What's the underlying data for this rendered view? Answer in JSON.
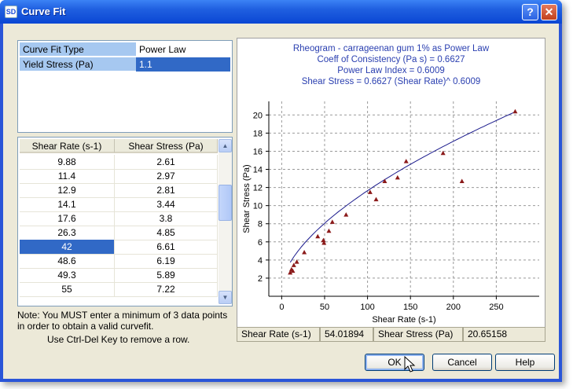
{
  "window": {
    "title": "Curve Fit",
    "app_icon": "SD",
    "help_glyph": "?",
    "close_glyph": "✕"
  },
  "properties": [
    {
      "name": "Curve Fit Type",
      "value": "Power Law"
    },
    {
      "name": "Yield Stress (Pa)",
      "value": "1.1"
    }
  ],
  "table": {
    "headers": [
      "Shear Rate (s-1)",
      "Shear Stress (Pa)"
    ],
    "rows": [
      [
        "9.88",
        "2.61"
      ],
      [
        "11.4",
        "2.97"
      ],
      [
        "12.9",
        "2.81"
      ],
      [
        "14.1",
        "3.44"
      ],
      [
        "17.6",
        "3.8"
      ],
      [
        "26.3",
        "4.85"
      ],
      [
        "42",
        "6.61"
      ],
      [
        "48.6",
        "6.19"
      ],
      [
        "49.3",
        "5.89"
      ],
      [
        "55",
        "7.22"
      ]
    ],
    "selected_row": 6
  },
  "note": "Note: You MUST enter a minimum of 3 data points in order to obtain a valid curvefit.",
  "hint": "Use Ctrl-Del Key to remove a row.",
  "chart_data": {
    "type": "scatter",
    "title_lines": [
      "Rheogram - carrageenan gum 1% as Power Law",
      "Coeff of Consistency (Pa s) = 0.6627",
      "Power Law Index = 0.6009",
      "Shear Stress = 0.6627 (Shear Rate)^ 0.6009"
    ],
    "xlabel": "Shear Rate (s-1)",
    "ylabel": "Shear Stress (Pa)",
    "xlim": [
      -15,
      300
    ],
    "ylim": [
      0,
      21.5
    ],
    "xticks": [
      "0",
      "50",
      "100",
      "150",
      "200",
      "250"
    ],
    "xtick_values": [
      0,
      50,
      100,
      150,
      200,
      250
    ],
    "yticks": [
      "2",
      "4",
      "6",
      "8",
      "10",
      "12",
      "14",
      "16",
      "18",
      "20"
    ],
    "ytick_values": [
      2,
      4,
      6,
      8,
      10,
      12,
      14,
      16,
      18,
      20
    ],
    "grid": true,
    "points": [
      [
        9.88,
        2.61
      ],
      [
        11.4,
        2.97
      ],
      [
        12.9,
        2.81
      ],
      [
        14.1,
        3.44
      ],
      [
        17.6,
        3.8
      ],
      [
        26.3,
        4.85
      ],
      [
        42,
        6.61
      ],
      [
        48.6,
        6.19
      ],
      [
        49.3,
        5.89
      ],
      [
        55,
        7.22
      ],
      [
        59,
        8.2
      ],
      [
        75,
        9.0
      ],
      [
        103,
        11.5
      ],
      [
        110,
        10.7
      ],
      [
        120,
        12.7
      ],
      [
        135,
        13.1
      ],
      [
        145,
        14.9
      ],
      [
        188,
        15.8
      ],
      [
        210,
        12.7
      ],
      [
        272,
        20.4
      ]
    ],
    "fit": {
      "a": 0.6627,
      "n": 0.6009,
      "yield": 1.1,
      "x_start": 10,
      "x_end": 270
    },
    "point_color": "#8b1a1a",
    "line_color": "#1a1a8c"
  },
  "status": {
    "xlabel": "Shear Rate (s-1)",
    "xval": "54.01894",
    "ylabel": "Shear Stress (Pa)",
    "yval": "20.65158"
  },
  "buttons": {
    "ok": "OK",
    "cancel": "Cancel",
    "help": "Help"
  }
}
